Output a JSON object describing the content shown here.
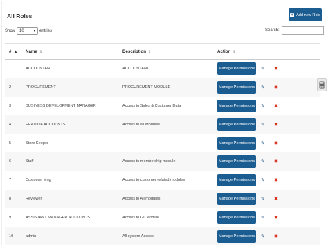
{
  "title": "All Roles",
  "add_button_label": "Add new Role",
  "length": {
    "show_label": "Show",
    "value": "10",
    "entries_label": "entries"
  },
  "search": {
    "label": "Search:",
    "value": ""
  },
  "columns": {
    "num": "#",
    "name": "Name",
    "description": "Description",
    "action": "Action"
  },
  "action_button_label": "Manage Permissions",
  "rows": [
    {
      "num": "1",
      "name": "ACCOUNTANT",
      "description": "ACCOUNTANT"
    },
    {
      "num": "2",
      "name": "PROCUREMENT",
      "description": "PROCUREMENT MODULE"
    },
    {
      "num": "3",
      "name": "BUSINESS DEVELOPMENT MANAGER",
      "description": "Access to Sales & Customer Data"
    },
    {
      "num": "4",
      "name": "HEAD OF ACCOUNTS",
      "description": "Access to all Modules"
    },
    {
      "num": "5",
      "name": "Store Keeper",
      "description": ""
    },
    {
      "num": "6",
      "name": "Staff",
      "description": "Access to membership module"
    },
    {
      "num": "7",
      "name": "Customer Mng",
      "description": "Access to customer related modules"
    },
    {
      "num": "8",
      "name": "Reviewer",
      "description": "Access to All modules"
    },
    {
      "num": "9",
      "name": "ASSISTANT MANAGER ACCOUNTS",
      "description": "Access to GL Module"
    },
    {
      "num": "10",
      "name": "admin",
      "description": "All system Access"
    }
  ],
  "icons": {
    "edit": "pencil-icon",
    "delete": "close-icon",
    "add": "plus-icon",
    "calculator": "calculator-icon"
  },
  "colors": {
    "primary": "#1c5d91",
    "delete": "#d9321f"
  }
}
